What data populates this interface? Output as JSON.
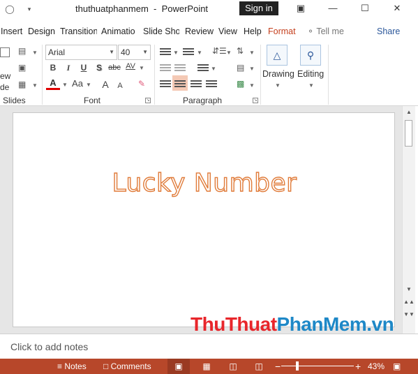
{
  "window": {
    "title": "thuthuatphanmem  -  PowerPoint",
    "sign_in": "Sign in"
  },
  "tabs": [
    "Insert",
    "Design",
    "Transition",
    "Animatio",
    "Slide Sho",
    "Review",
    "View",
    "Help",
    "Format"
  ],
  "active_tab": "Format",
  "tell_me": "Tell me",
  "share": "Share",
  "ribbon": {
    "slides_group": {
      "label": "Slides",
      "cut_text_1": "ew",
      "cut_text_2": "de"
    },
    "font_group": {
      "label": "Font",
      "font_name": "Arial",
      "font_size": "40",
      "bold": "B",
      "italic": "I",
      "underline": "U",
      "shadow": "S",
      "strike": "abc",
      "spacing": "AV",
      "case": "Aa",
      "grow": "A",
      "shrink": "A",
      "font_color": "A"
    },
    "paragraph_group": {
      "label": "Paragraph",
      "active_alignment": "center"
    },
    "drawing": {
      "label": "Drawing"
    },
    "editing": {
      "label": "Editing"
    }
  },
  "slide": {
    "title_text": "Lucky Number",
    "title_outline_color": "#e07b39"
  },
  "watermark": {
    "part1": "Thu",
    "part2": "Thuat",
    "part3": "PhanMem",
    "part4": ".vn",
    "red": "#e8262b",
    "blue": "#1e88c7"
  },
  "notes": {
    "placeholder": "Click to add notes"
  },
  "status_bar": {
    "notes": "Notes",
    "comments": "Comments",
    "zoom": "43%",
    "zoom_level": 0.43,
    "active_view": "normal",
    "color": "#b7472a"
  }
}
